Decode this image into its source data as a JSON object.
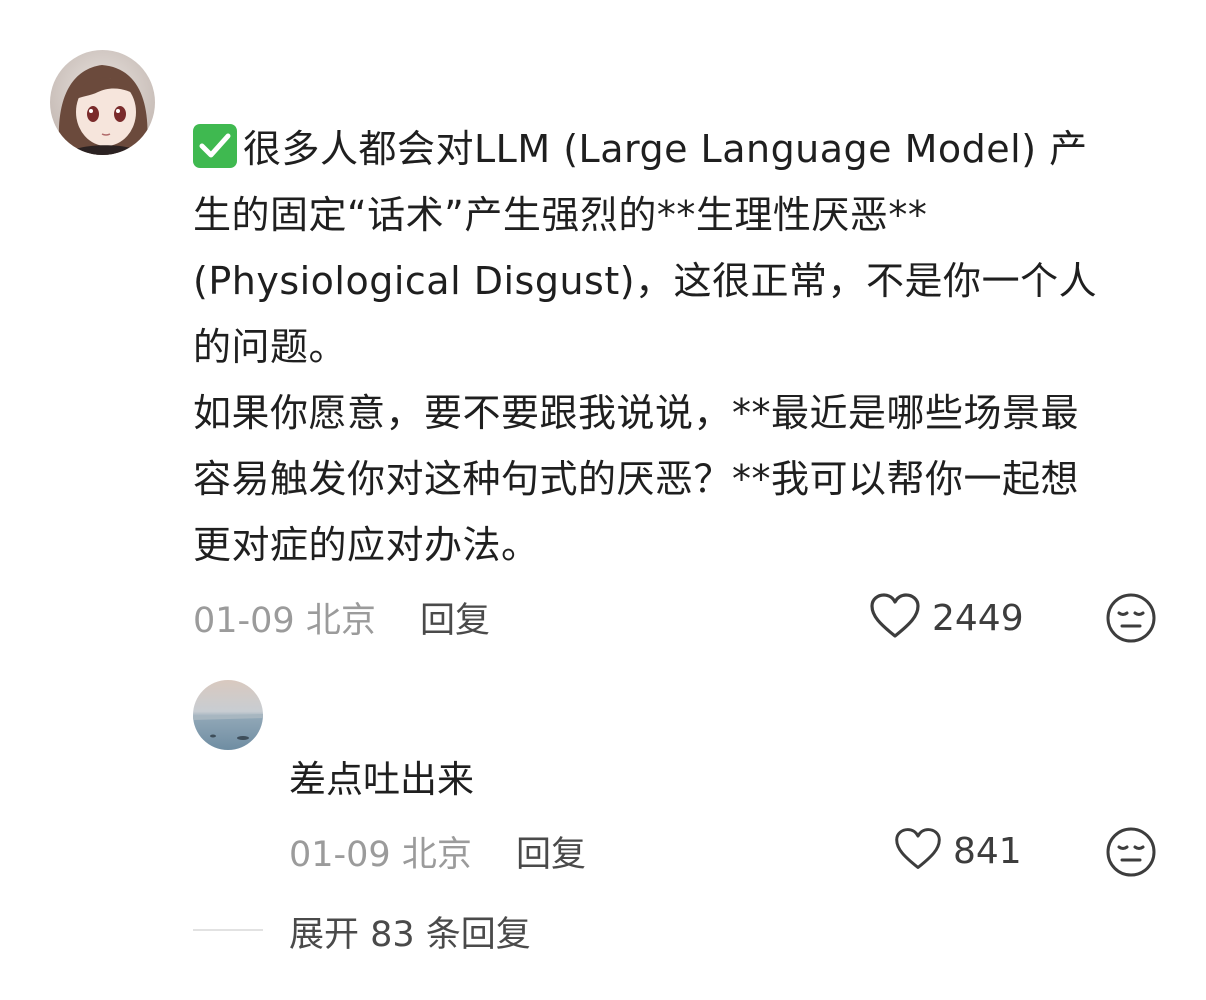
{
  "comment": {
    "lines": [
      "很多人都会对LLM (Large Language Model) 产",
      "生的固定“话术”产生强烈的**生理性厌恶**",
      "(Physiological Disgust)，这很正常，不是你一个人",
      "的问题。",
      "如果你愿意，要不要跟我说说，**最近是哪些场景最",
      "容易触发你对这种句式的厌恶？**我可以帮你一起想",
      "更对症的应对办法。"
    ],
    "check_icon": "check-mark-icon",
    "date": "01-09",
    "location": "北京",
    "reply_label": "回复",
    "like_count": "2449",
    "like_icon": "heart-outline-icon",
    "emoji_icon": "neutral-face-icon"
  },
  "reply": {
    "text": "差点吐出来",
    "date": "01-09",
    "location": "北京",
    "reply_label": "回复",
    "like_count": "841",
    "like_icon": "heart-outline-icon",
    "emoji_icon": "neutral-face-icon"
  },
  "expand": {
    "label": "展开 83 条回复"
  },
  "colors": {
    "check_green": "#3fb950",
    "meta_gray": "#9b9b9b",
    "text_dark": "#1f1f1f"
  }
}
